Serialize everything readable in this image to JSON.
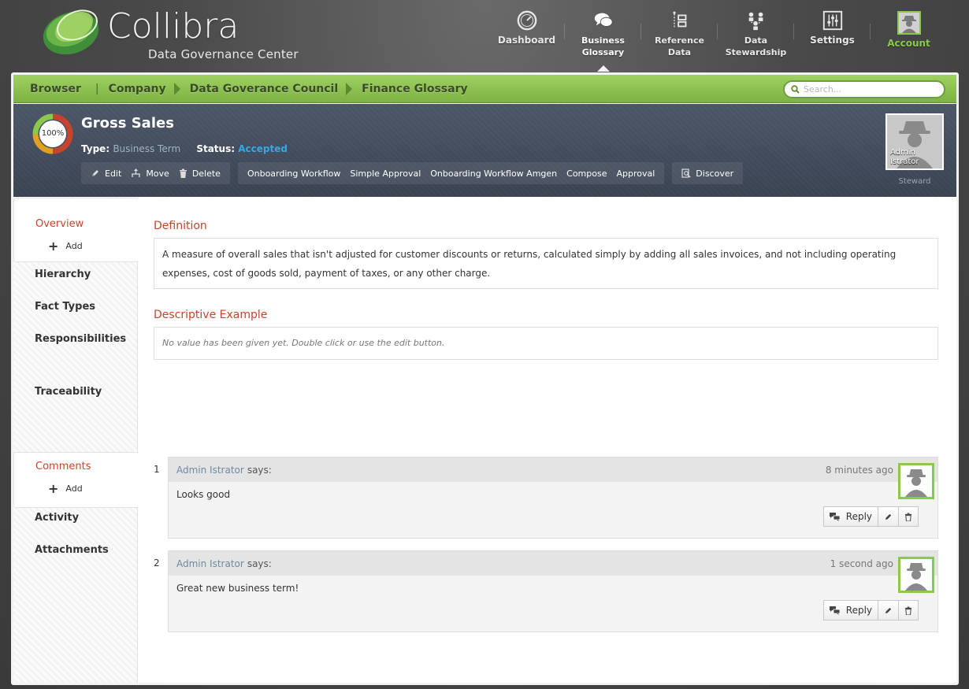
{
  "app": {
    "logo_name": "Collibra",
    "logo_subtitle": "Data Governance Center",
    "colors": {
      "brand_green": "#8cc84b",
      "accent_red": "#c8432c",
      "status_blue": "#35a9e0",
      "dark_header": "#3f4857"
    }
  },
  "topnav": {
    "items": [
      {
        "label": "Dashboard",
        "icon": "dashboard-gauge-icon"
      },
      {
        "label": "Business Glossary",
        "line1": "Business",
        "line2": "Glossary",
        "icon": "chat-bubbles-icon",
        "active": true
      },
      {
        "label": "Reference Data",
        "line1": "Reference",
        "line2": "Data",
        "icon": "tree-list-icon"
      },
      {
        "label": "Data Stewardship",
        "line1": "Data",
        "line2": "Stewardship",
        "icon": "people-network-icon"
      },
      {
        "label": "Settings",
        "icon": "sliders-icon"
      },
      {
        "label": "Account",
        "icon": "user-avatar-icon"
      }
    ]
  },
  "breadcrumb": {
    "root": "Browser",
    "items": [
      "Company",
      "Data Goverance Council",
      "Finance Glossary"
    ]
  },
  "search": {
    "placeholder": "Search..."
  },
  "asset": {
    "progress_label": "100%",
    "progress_value": 1.0,
    "title": "Gross Sales",
    "type_label": "Type:",
    "type_value": "Business Term",
    "status_label": "Status:",
    "status_value": "Accepted"
  },
  "actions": {
    "edit": "Edit",
    "move": "Move",
    "delete": "Delete",
    "workflows": [
      "Onboarding Workflow",
      "Simple Approval",
      "Onboarding Workflow Amgen",
      "Compose",
      "Approval"
    ],
    "discover": "Discover"
  },
  "steward": {
    "name_line1": "Admin",
    "name_line2": "Istrator",
    "role": "Steward"
  },
  "sidebar": {
    "overview": "Overview",
    "add": "Add",
    "hierarchy": "Hierarchy",
    "fact_types": "Fact Types",
    "responsibilities": "Responsibilities",
    "traceability": "Traceability",
    "comments": "Comments",
    "activity": "Activity",
    "attachments": "Attachments"
  },
  "definition": {
    "title": "Definition",
    "text": "A measure of overall sales that isn't adjusted for customer discounts or returns, calculated simply by adding all sales invoices, and not including operating expenses, cost of goods sold, payment of taxes, or any other charge."
  },
  "descriptive_example": {
    "title": "Descriptive Example",
    "empty_text": "No value has been given yet. Double click or use the edit button."
  },
  "comments": [
    {
      "number": "1",
      "author": "Admin Istrator",
      "says": "says:",
      "time": "8 minutes ago",
      "body": "Looks good",
      "reply": "Reply"
    },
    {
      "number": "2",
      "author": "Admin Istrator",
      "says": "says:",
      "time": "1 second ago",
      "body": "Great new business term!",
      "reply": "Reply"
    }
  ]
}
